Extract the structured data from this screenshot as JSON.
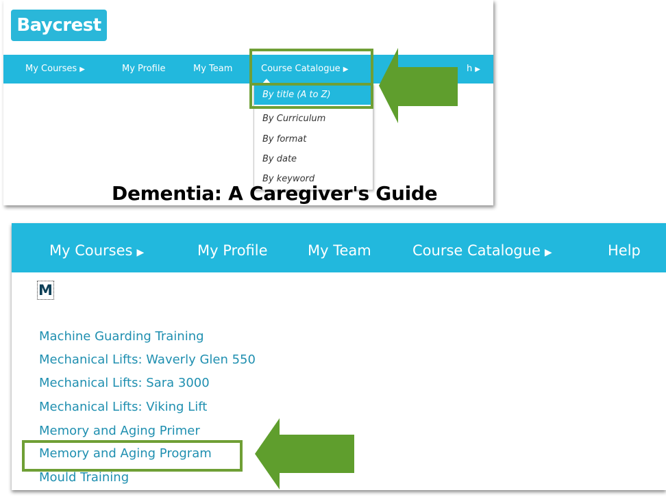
{
  "panel1": {
    "logo_text": "Baycrest",
    "nav": {
      "my_courses": "My Courses",
      "my_profile": "My Profile",
      "my_team": "My Team",
      "course_catalogue": "Course Catalogue",
      "partial_item": "h"
    },
    "dropdown": [
      "By title (A to Z)",
      "By Curriculum",
      "By format",
      "By date",
      "By keyword"
    ],
    "page_title": "Dementia: A Caregiver's Guide"
  },
  "panel2": {
    "nav": {
      "my_courses": "My Courses",
      "my_profile": "My Profile",
      "my_team": "My Team",
      "course_catalogue": "Course Catalogue",
      "help": "Help"
    },
    "section_letter": "M",
    "courses": [
      "Machine Guarding Training",
      "Mechanical Lifts: Waverly Glen 550",
      "Mechanical Lifts: Sara 3000",
      "Mechanical Lifts: Viking Lift",
      "Memory and Aging Primer",
      "Memory and Aging Program",
      "Mould Training"
    ]
  },
  "colors": {
    "nav_blue": "#22b8dd",
    "highlight_green": "#6f9f35",
    "link_blue": "#1f8fb0",
    "arrow_green": "#5f9e2d"
  },
  "icons": {
    "submenu_arrow": "triangle-right-icon",
    "callout_arrow": "arrow-left-icon"
  }
}
